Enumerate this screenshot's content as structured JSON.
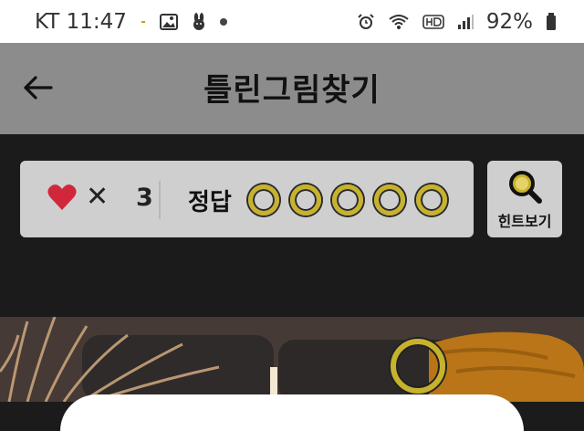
{
  "status_bar": {
    "carrier_time": "KT 11:47",
    "battery": "92%"
  },
  "app_bar": {
    "title": "틀린그림찾기",
    "back_icon": "arrow-left-icon"
  },
  "game": {
    "lives_symbol": "✕",
    "lives_count": "3",
    "answer_label": "정답",
    "answers_total": 5,
    "answers_found": 0,
    "hint_label": "힌트보기",
    "accent_color": "#c7b22d",
    "heart_color": "#d0283a"
  }
}
